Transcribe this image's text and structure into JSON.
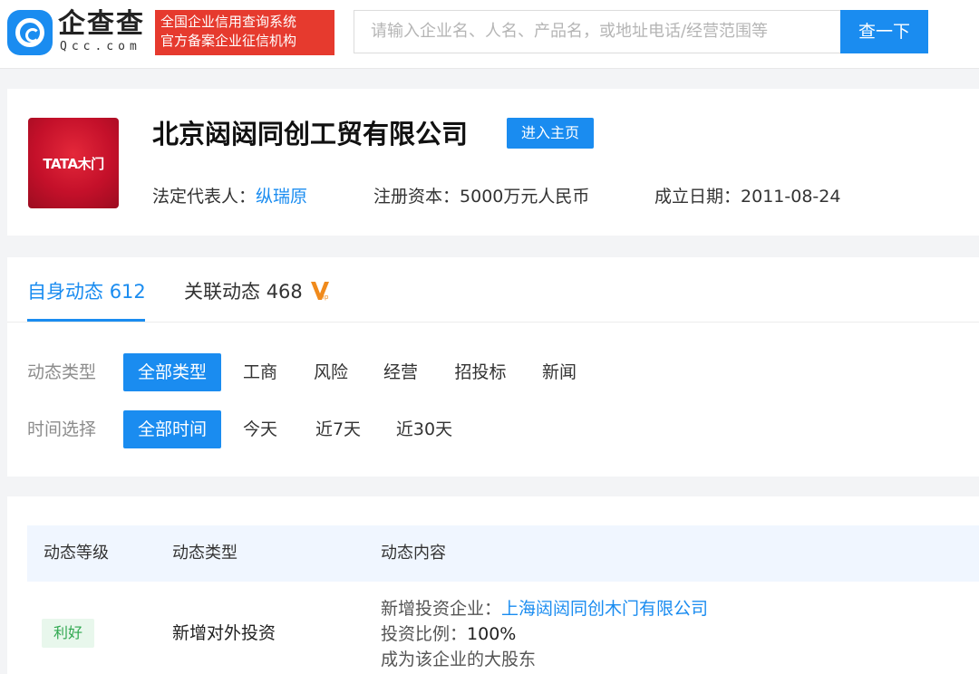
{
  "header": {
    "logo_text": "企查查",
    "logo_sub": "Qcc.com",
    "slogan_line1": "全国企业信用查询系统",
    "slogan_line2": "官方备案企业征信机构",
    "search_placeholder": "请输入企业名、人名、产品名，或地址电话/经营范围等",
    "search_button": "查一下"
  },
  "company": {
    "logo_text": "TATA木门",
    "name": "北京闼闼同创工贸有限公司",
    "home_button": "进入主页",
    "legal_rep_label": "法定代表人：",
    "legal_rep": "纵瑞原",
    "capital_label": "注册资本：",
    "capital": "5000万元人民币",
    "founded_label": "成立日期：",
    "founded": "2011-08-24"
  },
  "tabs": [
    {
      "label": "自身动态",
      "count": "612"
    },
    {
      "label": "关联动态",
      "count": "468"
    }
  ],
  "filters": {
    "type_label": "动态类型",
    "types": [
      "全部类型",
      "工商",
      "风险",
      "经营",
      "招投标",
      "新闻"
    ],
    "time_label": "时间选择",
    "times": [
      "全部时间",
      "今天",
      "近7天",
      "近30天"
    ]
  },
  "table": {
    "headers": [
      "动态等级",
      "动态类型",
      "动态内容"
    ],
    "rows": [
      {
        "level": "利好",
        "type": "新增对外投资",
        "content": {
          "company_label": "新增投资企业：",
          "company": "上海闼闼同创木门有限公司",
          "ratio_label": "投资比例：",
          "ratio": "100%",
          "note": "成为该企业的大股东"
        }
      }
    ]
  },
  "colors": {
    "accent": "#1a8cf0",
    "slogan_bg": "#e63a2e",
    "positive": "#2fa84f"
  }
}
